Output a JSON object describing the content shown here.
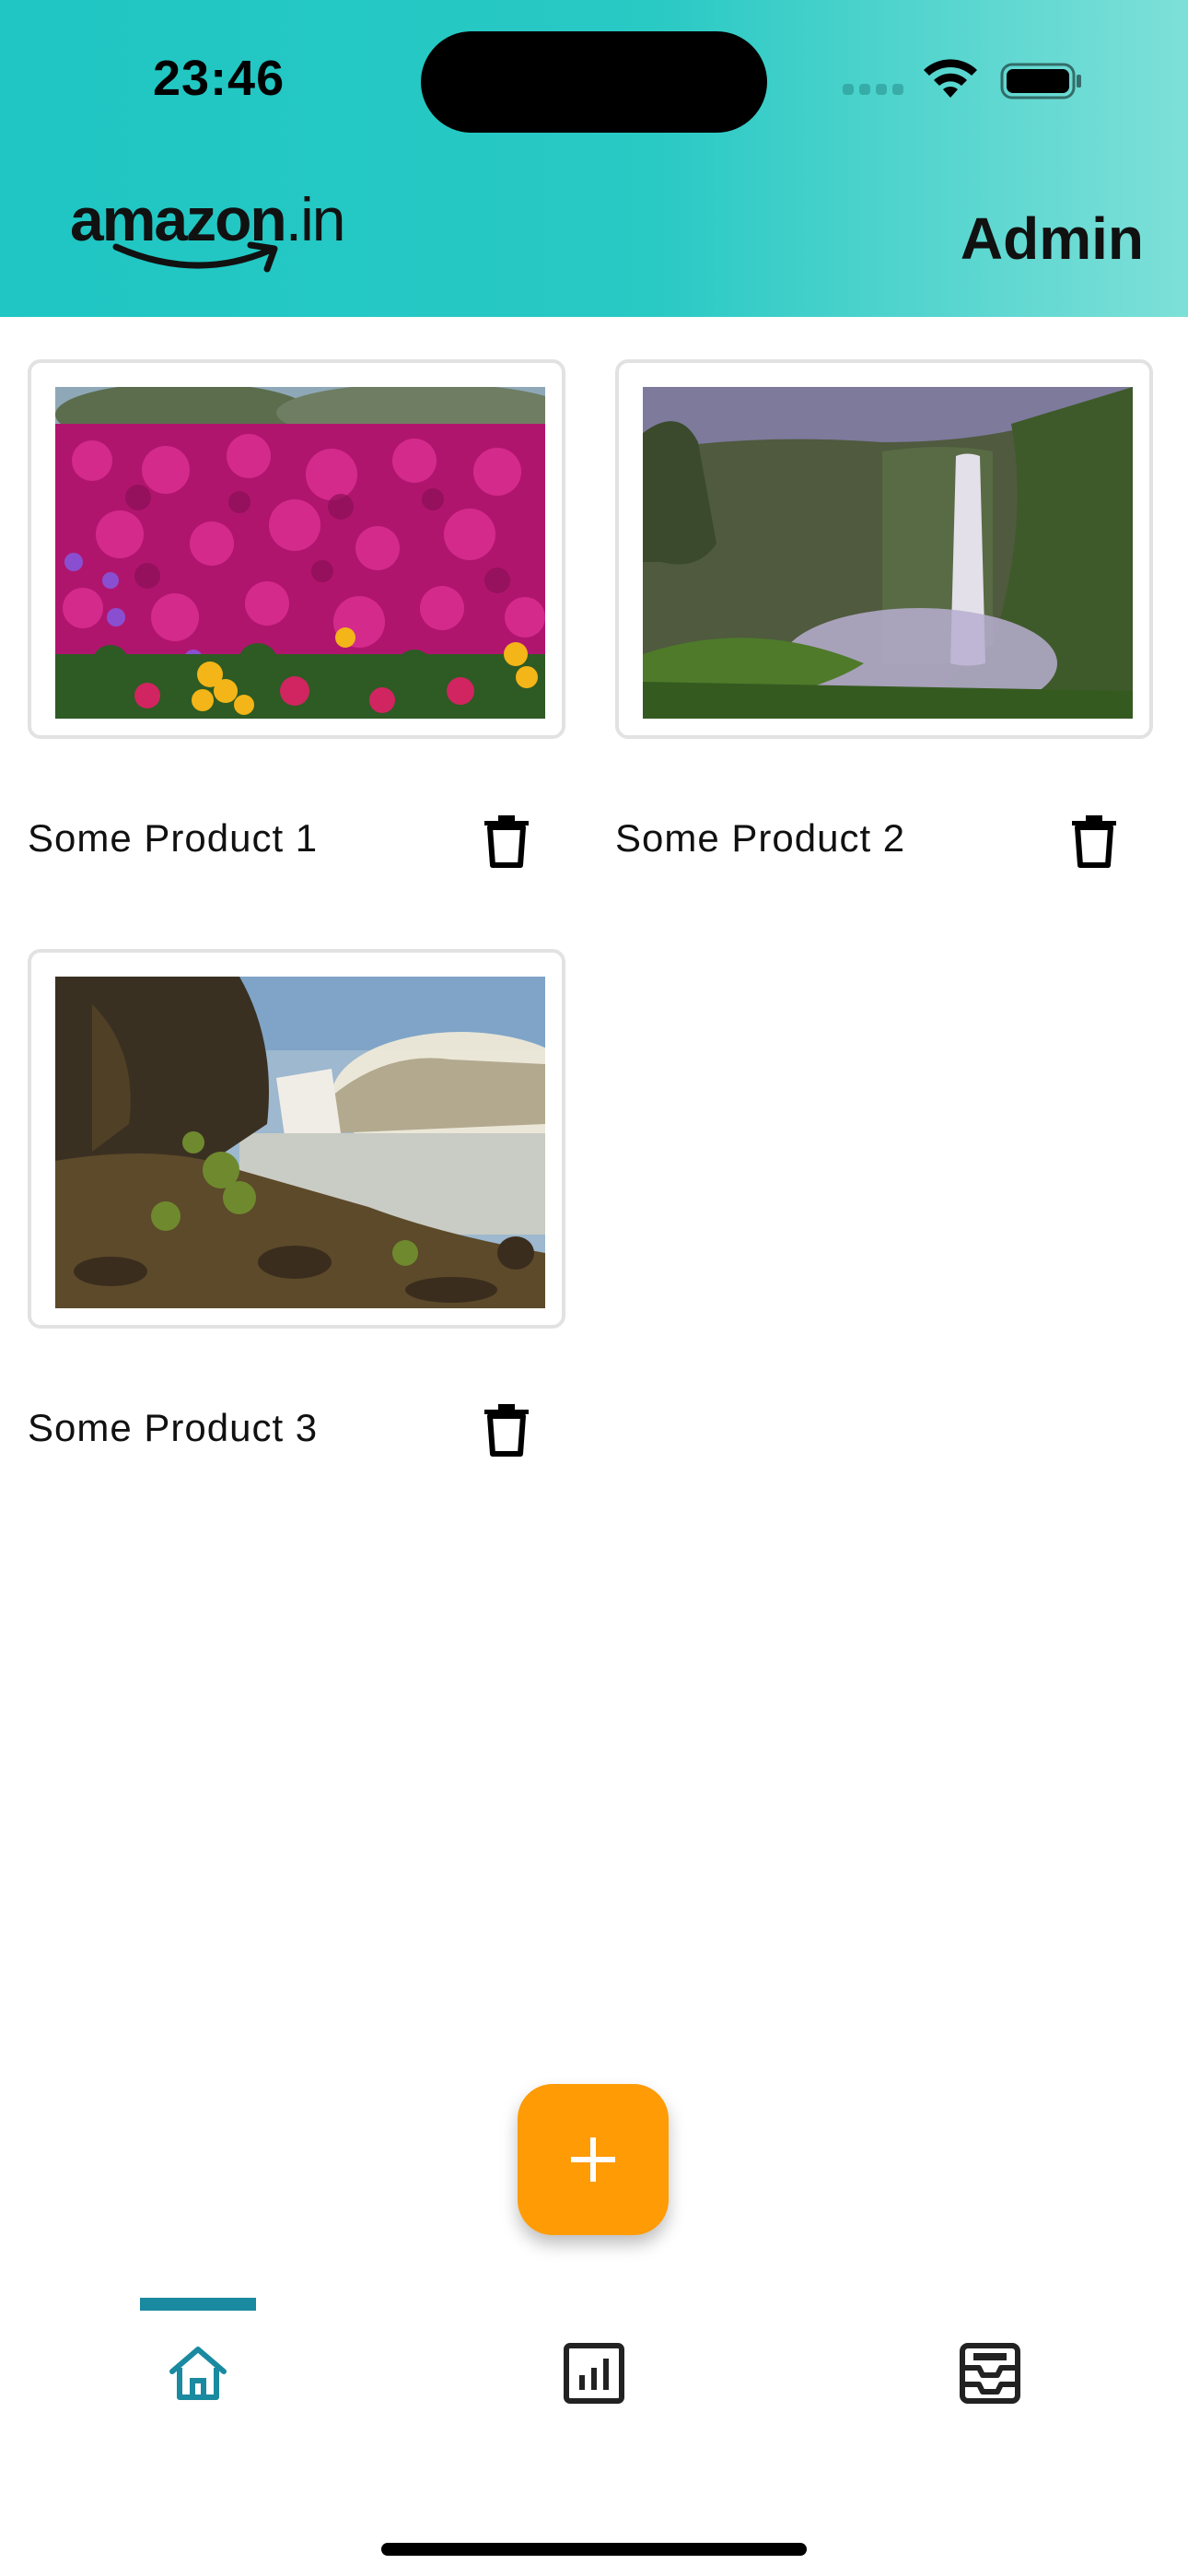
{
  "status_bar": {
    "time": "23:46"
  },
  "header": {
    "logo_text": "amazon",
    "logo_suffix": ".in",
    "title": "Admin",
    "background": "#1fc6c3"
  },
  "products": [
    {
      "name": "Some Product 1",
      "image": "magenta-flowers-photo"
    },
    {
      "name": "Some Product 2",
      "image": "waterfall-cliff-photo"
    },
    {
      "name": "Some Product 3",
      "image": "waterfall-river-photo"
    }
  ],
  "fab": {
    "icon": "plus-icon",
    "color": "#ff9b05"
  },
  "bottom_nav": {
    "items": [
      {
        "icon": "home-icon",
        "active": true
      },
      {
        "icon": "analytics-icon",
        "active": false
      },
      {
        "icon": "inbox-icon",
        "active": false
      }
    ],
    "active_color": "#1a8aa0"
  }
}
